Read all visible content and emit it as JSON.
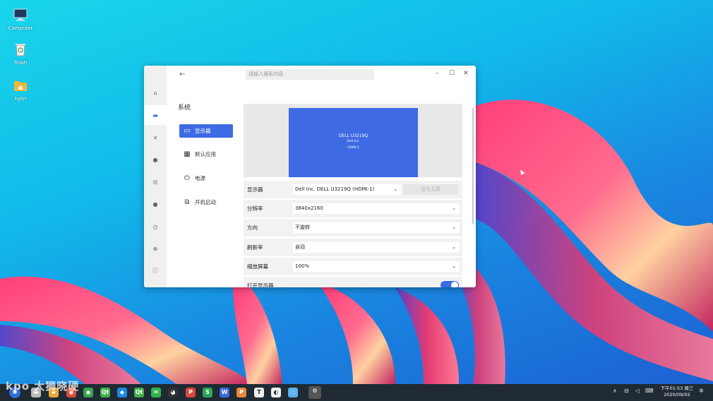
{
  "desktop": {
    "icons": [
      {
        "label": "Computer"
      },
      {
        "label": "Trash"
      },
      {
        "label": "kylin"
      }
    ]
  },
  "window": {
    "back_glyph": "←",
    "search_placeholder": "请输入搜索内容",
    "controls": {
      "minimize": "–",
      "maximize": "☐",
      "close": "✕"
    },
    "section_title": "系统",
    "menu": [
      {
        "label": "显示器",
        "icon": "monitor-icon",
        "glyph": "▭",
        "active": true
      },
      {
        "label": "默认应用",
        "icon": "grid-icon",
        "glyph": "▦",
        "active": false
      },
      {
        "label": "电源",
        "icon": "power-icon",
        "glyph": "⏻",
        "active": false
      },
      {
        "label": "开机启动",
        "icon": "startup-icon",
        "glyph": "⧉",
        "active": false
      }
    ],
    "rail": [
      {
        "icon": "home-icon",
        "glyph": "⌂"
      },
      {
        "icon": "display-icon",
        "glyph": "▬"
      },
      {
        "icon": "tools-icon",
        "glyph": "✕"
      },
      {
        "icon": "palette-icon",
        "glyph": "●"
      },
      {
        "icon": "network-icon",
        "glyph": "◎"
      },
      {
        "icon": "account-icon",
        "glyph": "●"
      },
      {
        "icon": "time-icon",
        "glyph": "◷"
      },
      {
        "icon": "globe-icon",
        "glyph": "⊕"
      },
      {
        "icon": "info-icon",
        "glyph": "ⓘ"
      }
    ],
    "preview": {
      "monitor_name": "DELL U3219Q",
      "vendor": "Dell Inc.",
      "port": "HDMI-1"
    },
    "rows": [
      {
        "label": "显示器",
        "value": "Dell Inc. DELL U3219Q (HDMI-1)",
        "button": "设为主屏"
      },
      {
        "label": "分辨率",
        "value": "3840x2160"
      },
      {
        "label": "方向",
        "value": "不旋转"
      },
      {
        "label": "刷新率",
        "value": "自动"
      },
      {
        "label": "缩放屏幕",
        "value": "100%"
      },
      {
        "label": "打开显示器",
        "toggle_on": true
      }
    ],
    "chevron": "⌄",
    "accent": "#3d6be5"
  },
  "taskbar": {
    "apps": [
      {
        "icon": "start-menu-icon",
        "glyph": "◉",
        "color": "#2f6fd6"
      },
      {
        "icon": "file-manager-icon",
        "glyph": "▬",
        "color": "#bbbbbb"
      },
      {
        "icon": "folder-icon",
        "glyph": "▰",
        "color": "#e7a93a"
      },
      {
        "icon": "chrome-icon",
        "glyph": "◉",
        "color": "#e04b3a"
      },
      {
        "icon": "browser-icon",
        "glyph": "◉",
        "color": "#3aa14a"
      },
      {
        "icon": "qt-creator-icon",
        "glyph": "Qt",
        "color": "#41b04a"
      },
      {
        "icon": "vscode-icon",
        "glyph": "◆",
        "color": "#1e88e5"
      },
      {
        "icon": "qt-designer-icon",
        "glyph": "Qt",
        "color": "#41b04a"
      },
      {
        "icon": "wechat-icon",
        "glyph": "✉",
        "color": "#2fb44b"
      },
      {
        "icon": "qq-icon",
        "glyph": "◕",
        "color": "#333333"
      },
      {
        "icon": "wps-presentation-icon",
        "glyph": "P",
        "color": "#d9463a"
      },
      {
        "icon": "wps-spreadsheet-icon",
        "glyph": "S",
        "color": "#2fa35a"
      },
      {
        "icon": "wps-writer-icon",
        "glyph": "W",
        "color": "#3d6be5"
      },
      {
        "icon": "wps-pdf-icon",
        "glyph": "P",
        "color": "#e8863a"
      },
      {
        "icon": "text-editor-icon",
        "glyph": "T",
        "color": "#eeeeee"
      },
      {
        "icon": "screenshot-icon",
        "glyph": "◐",
        "color": "#f1f1f1"
      },
      {
        "icon": "app-store-icon",
        "glyph": "◌",
        "color": "#5ab0f0"
      },
      {
        "icon": "settings-icon",
        "glyph": "⚙",
        "color": "#555555"
      }
    ],
    "tray": [
      {
        "icon": "arrow-up-icon",
        "glyph": "∧"
      },
      {
        "icon": "network-tray-icon",
        "glyph": "⊟"
      },
      {
        "icon": "volume-icon",
        "glyph": "◁"
      },
      {
        "icon": "keyboard-icon",
        "glyph": "⌨"
      }
    ],
    "time": "下午01:53 周三",
    "date": "2020/09/02",
    "watermark": "kpo 大狮晓硬"
  }
}
